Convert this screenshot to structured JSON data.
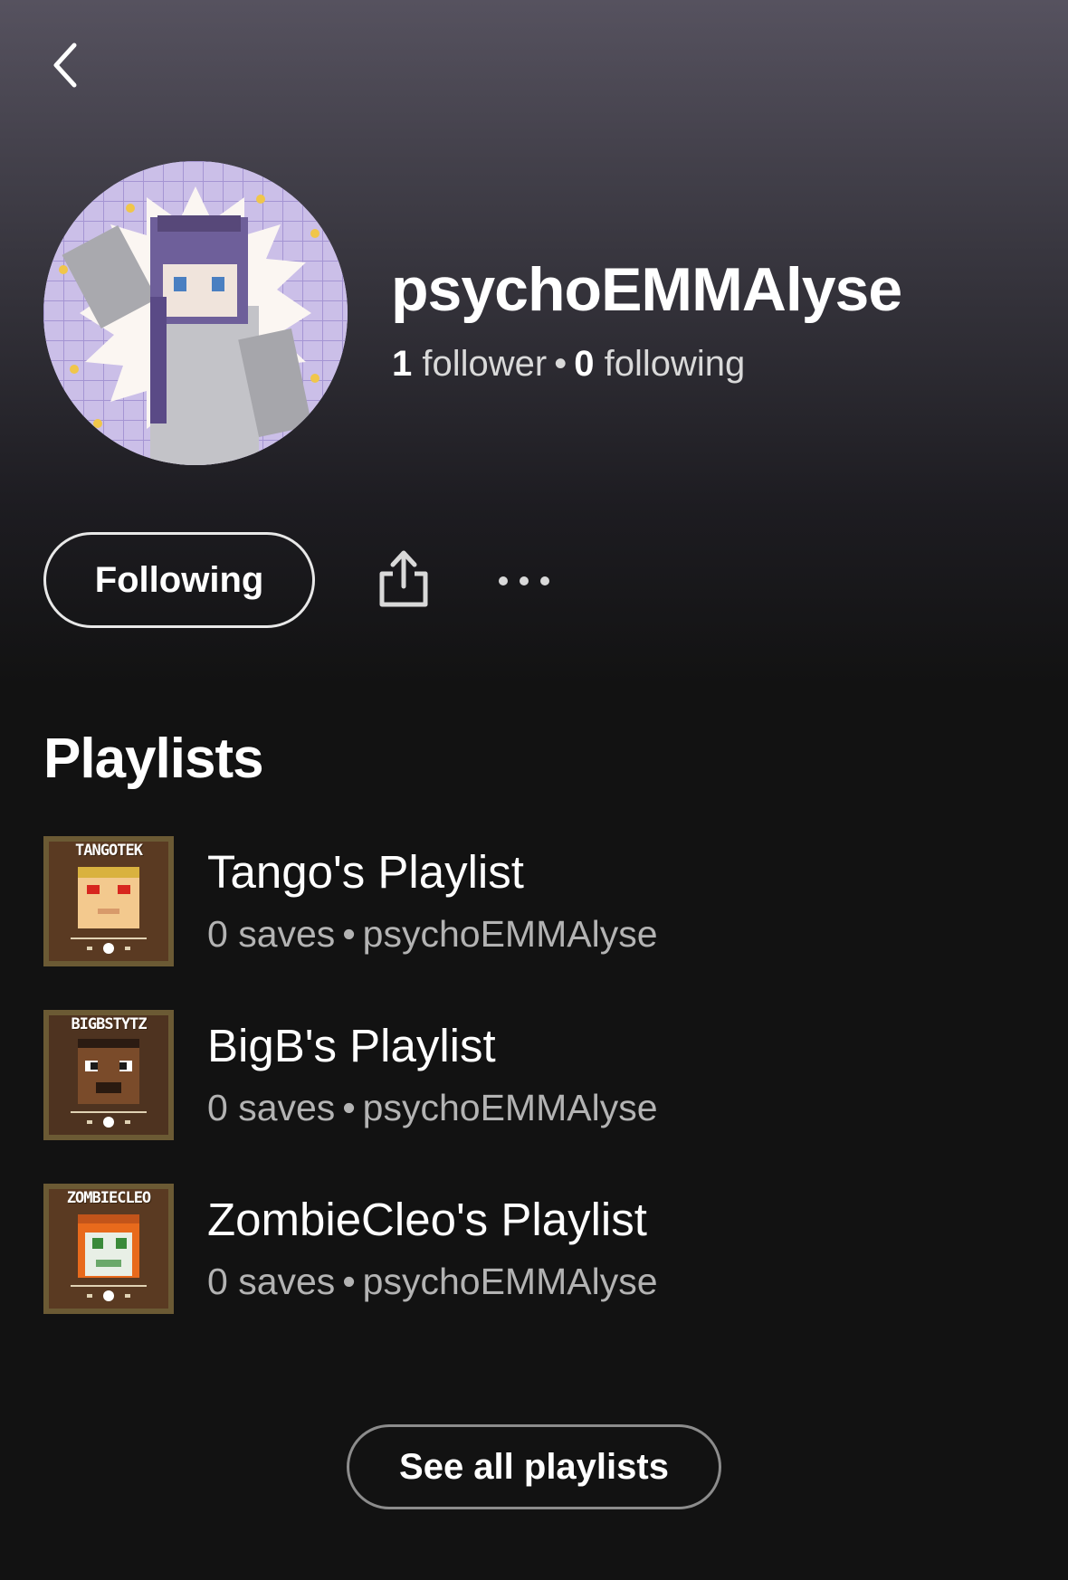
{
  "profile": {
    "username": "psychoEMMAlyse",
    "followers_count": "1",
    "followers_label": "follower",
    "separator": "•",
    "following_count": "0",
    "following_label": "following",
    "follow_button_label": "Following"
  },
  "icons": {
    "back": "chevron-left-icon",
    "share": "share-icon",
    "more": "more-horizontal-icon"
  },
  "playlists_section": {
    "title": "Playlists",
    "items": [
      {
        "cover_label": "TANGOTEK",
        "title": "Tango's Playlist",
        "saves": "0 saves",
        "separator": "•",
        "owner": "psychoEMMAlyse"
      },
      {
        "cover_label": "BIGBSTYTZ",
        "title": "BigB's Playlist",
        "saves": "0 saves",
        "separator": "•",
        "owner": "psychoEMMAlyse"
      },
      {
        "cover_label": "ZOMBIECLEO",
        "title": "ZombieCleo's Playlist",
        "saves": "0 saves",
        "separator": "•",
        "owner": "psychoEMMAlyse"
      }
    ],
    "see_all_label": "See all playlists"
  },
  "colors": {
    "background": "#121212",
    "header_gradient_top": "#56525f",
    "text_primary": "#ffffff",
    "text_secondary": "#b3b3b3"
  }
}
